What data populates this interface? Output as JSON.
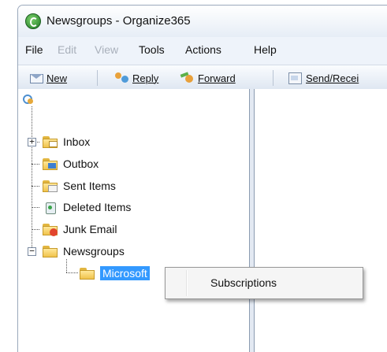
{
  "window": {
    "title": "Newsgroups - Organize365"
  },
  "menubar": {
    "items": [
      {
        "label": "File",
        "enabled": true
      },
      {
        "label": "Edit",
        "enabled": false
      },
      {
        "label": "View",
        "enabled": false
      },
      {
        "label": "Tools",
        "enabled": true
      },
      {
        "label": "Actions",
        "enabled": true
      },
      {
        "label": "Help",
        "enabled": true
      }
    ]
  },
  "toolbar": {
    "new_label": "New",
    "reply_label": "Reply",
    "forward_label": "Forward",
    "send_receive_label": "Send/Recei"
  },
  "folder_tree": {
    "items": [
      {
        "label": "Inbox",
        "icon": "inbox-folder-icon",
        "expander": "+"
      },
      {
        "label": "Outbox",
        "icon": "outbox-folder-icon"
      },
      {
        "label": "Sent Items",
        "icon": "sent-items-folder-icon"
      },
      {
        "label": "Deleted Items",
        "icon": "recycle-bin-icon"
      },
      {
        "label": "Junk Email",
        "icon": "junk-email-folder-icon"
      },
      {
        "label": "Newsgroups",
        "icon": "folder-icon",
        "expander": "−"
      },
      {
        "label": "Microsoft",
        "icon": "folder-icon",
        "selected": true
      }
    ]
  },
  "context_menu": {
    "items": [
      {
        "label": "Subscriptions"
      }
    ]
  },
  "colors": {
    "selection": "#3399ff",
    "window_background": "#eef3fa",
    "folder_yellow": "#f0c24b"
  }
}
